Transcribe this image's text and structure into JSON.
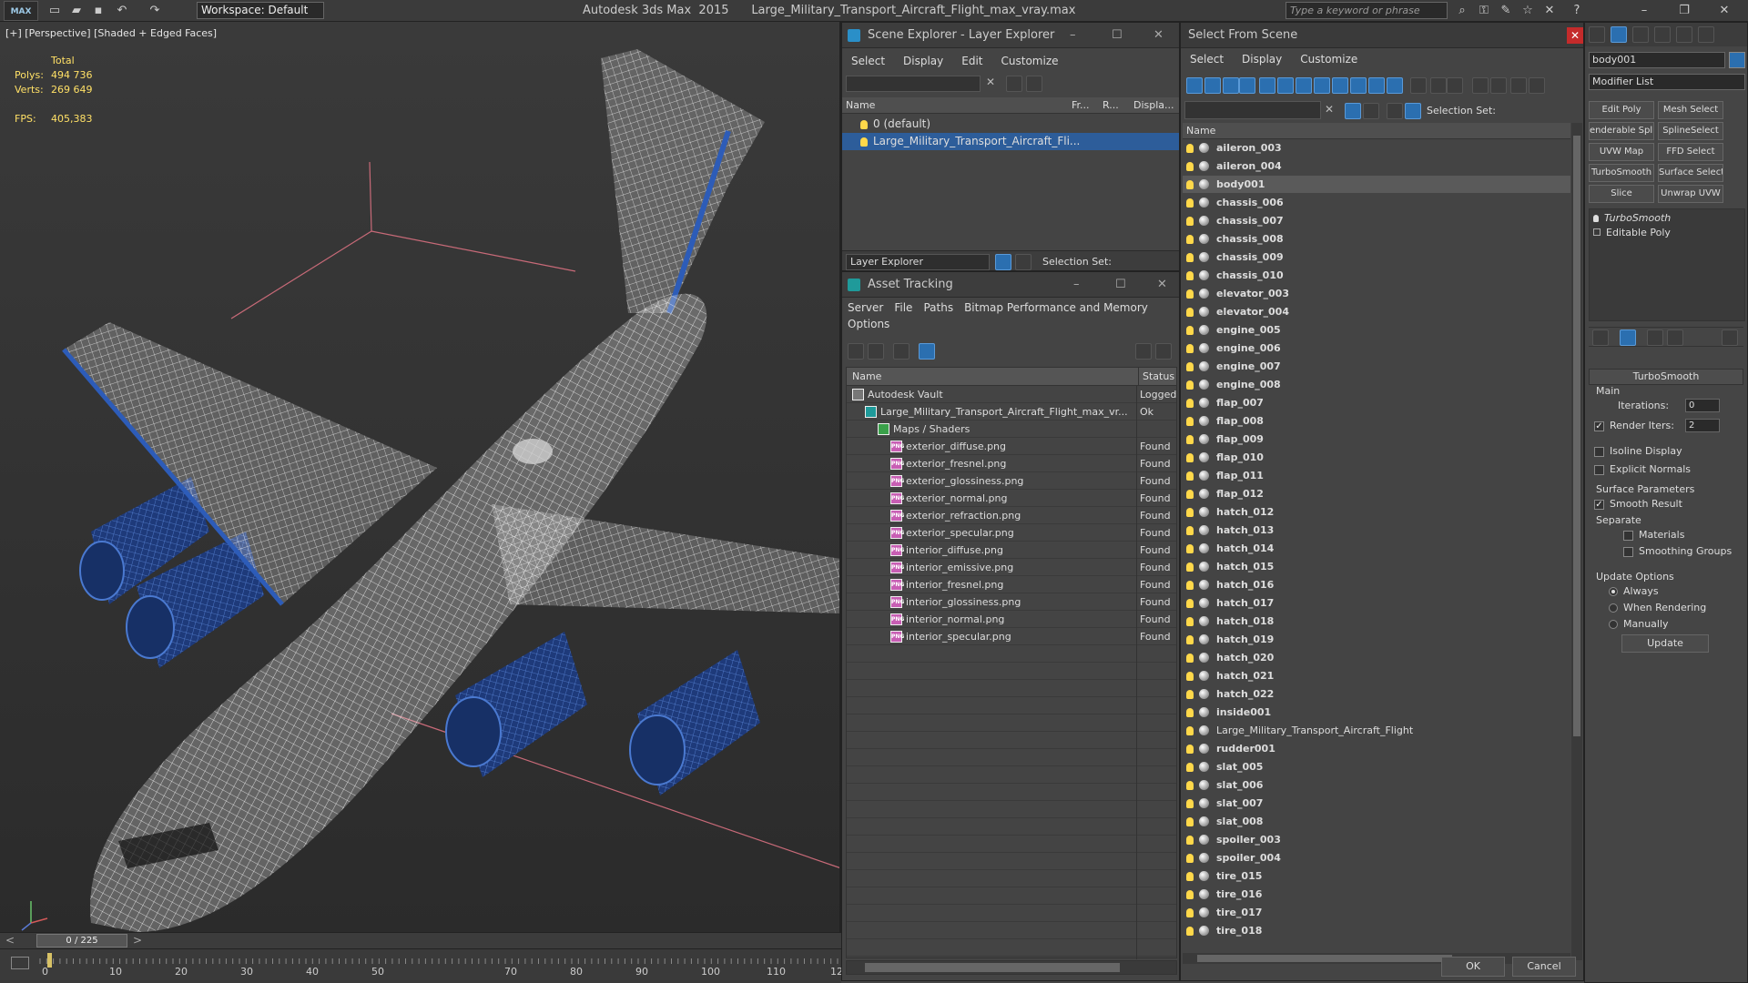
{
  "app": {
    "logo": "MAX",
    "title": "Autodesk 3ds Max  2015      Large_Military_Transport_Aircraft_Flight_max_vray.max",
    "workspace": "Workspace: Default",
    "search_placeholder": "Type a keyword or phrase"
  },
  "viewport": {
    "label": "[+] [Perspective] [Shaded + Edged Faces]",
    "stats": {
      "total_label": "Total",
      "polys_label": "Polys:",
      "polys_value": "494 736",
      "verts_label": "Verts:",
      "verts_value": "269 649",
      "fps_label": "FPS:",
      "fps_value": "405,383"
    }
  },
  "timeline": {
    "frame": "0 / 225",
    "ticks": [
      "0",
      "10",
      "20",
      "30",
      "40",
      "50",
      "70",
      "80",
      "90",
      "100",
      "110",
      "12"
    ]
  },
  "scene_explorer": {
    "title": "Scene Explorer - Layer Explorer",
    "menu": [
      "Select",
      "Display",
      "Edit",
      "Customize"
    ],
    "columns": [
      "Name",
      "Fr...",
      "R...",
      "Displa..."
    ],
    "rows": [
      {
        "name": "0 (default)"
      },
      {
        "name": "Large_Military_Transport_Aircraft_Fli..."
      }
    ],
    "layer_explorer": "Layer Explorer",
    "selection_set": "Selection Set:"
  },
  "asset_tracking": {
    "title": "Asset Tracking",
    "menu": [
      "Server",
      "File",
      "Paths",
      "Bitmap Performance and Memory"
    ],
    "menu2": [
      "Options"
    ],
    "columns": [
      "Name",
      "Status"
    ],
    "rows": [
      {
        "name": "Autodesk Vault",
        "status": "Logged",
        "type": "vault",
        "indent": 0
      },
      {
        "name": "Large_Military_Transport_Aircraft_Flight_max_vr...",
        "status": "Ok",
        "type": "max",
        "indent": 1
      },
      {
        "name": "Maps / Shaders",
        "status": "",
        "type": "folder",
        "indent": 2
      },
      {
        "name": "exterior_diffuse.png",
        "status": "Found",
        "type": "png",
        "indent": 3
      },
      {
        "name": "exterior_fresnel.png",
        "status": "Found",
        "type": "png",
        "indent": 3
      },
      {
        "name": "exterior_glossiness.png",
        "status": "Found",
        "type": "png",
        "indent": 3
      },
      {
        "name": "exterior_normal.png",
        "status": "Found",
        "type": "png",
        "indent": 3
      },
      {
        "name": "exterior_refraction.png",
        "status": "Found",
        "type": "png",
        "indent": 3
      },
      {
        "name": "exterior_specular.png",
        "status": "Found",
        "type": "png",
        "indent": 3
      },
      {
        "name": "interior_diffuse.png",
        "status": "Found",
        "type": "png",
        "indent": 3
      },
      {
        "name": "interior_emissive.png",
        "status": "Found",
        "type": "png",
        "indent": 3
      },
      {
        "name": "interior_fresnel.png",
        "status": "Found",
        "type": "png",
        "indent": 3
      },
      {
        "name": "interior_glossiness.png",
        "status": "Found",
        "type": "png",
        "indent": 3
      },
      {
        "name": "interior_normal.png",
        "status": "Found",
        "type": "png",
        "indent": 3
      },
      {
        "name": "interior_specular.png",
        "status": "Found",
        "type": "png",
        "indent": 3
      }
    ]
  },
  "select_from_scene": {
    "title": "Select From Scene",
    "menu": [
      "Select",
      "Display",
      "Customize"
    ],
    "selection_set": "Selection Set:",
    "column": "Name",
    "items": [
      "aileron_003",
      "aileron_004",
      "body001",
      "chassis_006",
      "chassis_007",
      "chassis_008",
      "chassis_009",
      "chassis_010",
      "elevator_003",
      "elevator_004",
      "engine_005",
      "engine_006",
      "engine_007",
      "engine_008",
      "flap_007",
      "flap_008",
      "flap_009",
      "flap_010",
      "flap_011",
      "flap_012",
      "hatch_012",
      "hatch_013",
      "hatch_014",
      "hatch_015",
      "hatch_016",
      "hatch_017",
      "hatch_018",
      "hatch_019",
      "hatch_020",
      "hatch_021",
      "hatch_022",
      "inside001",
      "Large_Military_Transport_Aircraft_Flight",
      "rudder001",
      "slat_005",
      "slat_006",
      "slat_007",
      "slat_008",
      "spoiler_003",
      "spoiler_004",
      "tire_015",
      "tire_016",
      "tire_017",
      "tire_018"
    ],
    "selected": "body001",
    "ok": "OK",
    "cancel": "Cancel"
  },
  "command_panel": {
    "object_name": "body001",
    "modifier_list": "Modifier List",
    "buttons": [
      "Edit Poly",
      "Mesh Select",
      "enderable Splir",
      "SplineSelect",
      "UVW Map",
      "FFD Select",
      "TurboSmooth",
      "Surface Select",
      "Slice",
      "Unwrap UVW"
    ],
    "stack": [
      "TurboSmooth",
      "Editable Poly"
    ],
    "rollout_title": "TurboSmooth",
    "main": "Main",
    "iterations_label": "Iterations:",
    "iterations_value": "0",
    "render_iters_label": "Render Iters:",
    "render_iters_value": "2",
    "isoline": "Isoline Display",
    "explicit_normals": "Explicit Normals",
    "surface_params": "Surface Parameters",
    "smooth_result": "Smooth Result",
    "separate": "Separate",
    "materials": "Materials",
    "smoothing_groups": "Smoothing Groups",
    "update_options": "Update Options",
    "always": "Always",
    "when_rendering": "When Rendering",
    "manually": "Manually",
    "update": "Update"
  }
}
